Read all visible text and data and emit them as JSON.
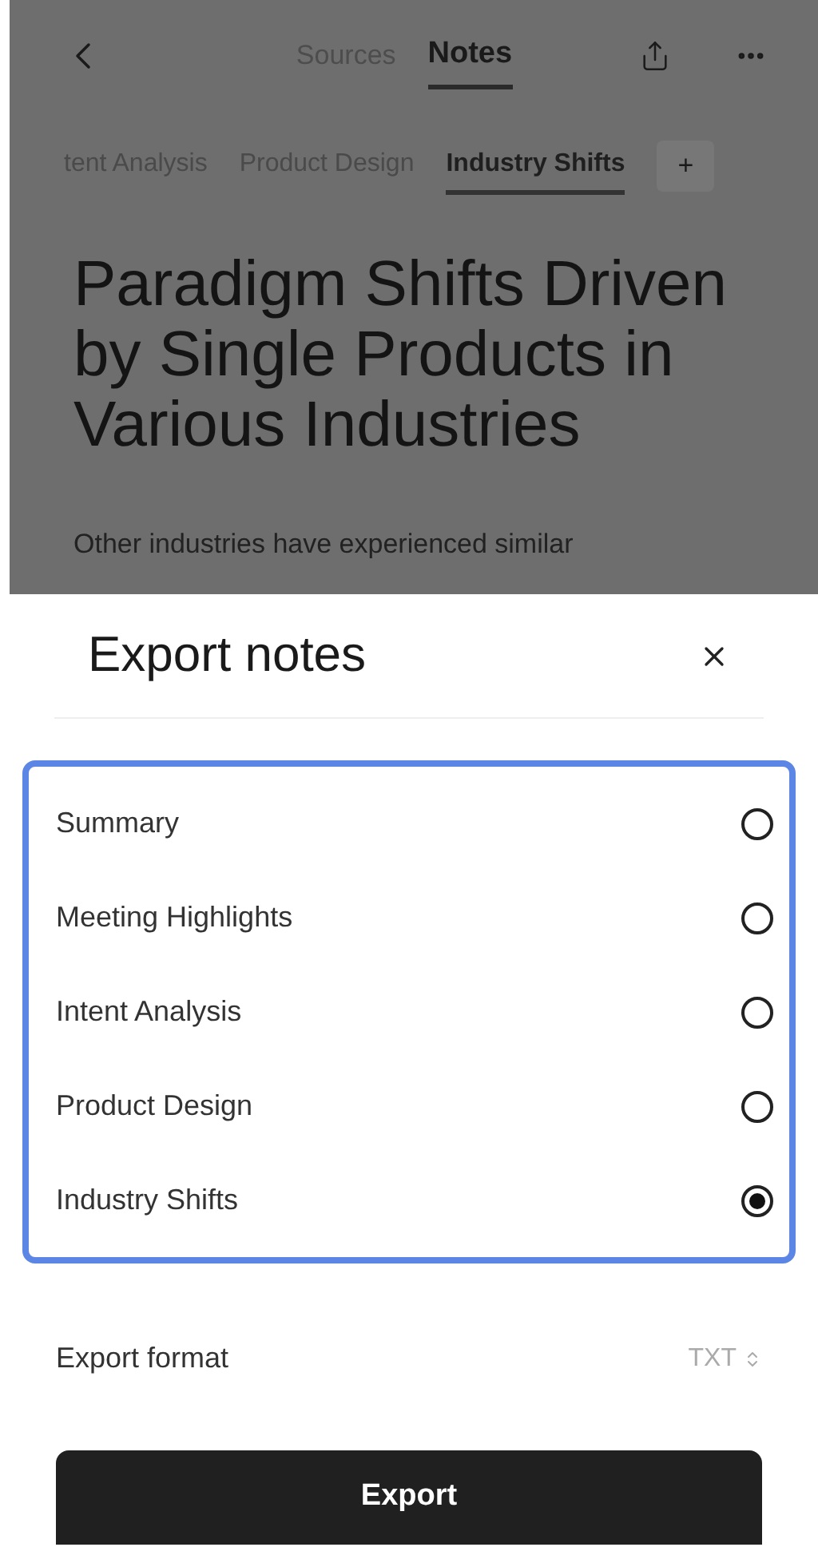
{
  "top_tabs": [
    {
      "label": "Sources",
      "selected": false
    },
    {
      "label": "Notes",
      "selected": true
    }
  ],
  "note_tabs": [
    {
      "label": "tent Analysis",
      "selected": false
    },
    {
      "label": "Product Design",
      "selected": false
    },
    {
      "label": "Industry Shifts",
      "selected": true
    }
  ],
  "add_tab": "+",
  "note": {
    "title": "Paradigm Shifts Driven by Single Products in Various Industries",
    "body": "Other industries have experienced similar"
  },
  "sheet": {
    "title": "Export notes",
    "options": [
      {
        "label": "Summary",
        "selected": false
      },
      {
        "label": "Meeting Highlights",
        "selected": false
      },
      {
        "label": "Intent Analysis",
        "selected": false
      },
      {
        "label": "Product Design",
        "selected": false
      },
      {
        "label": "Industry Shifts",
        "selected": true
      }
    ],
    "format_label": "Export format",
    "format_value": "TXT",
    "button": "Export"
  }
}
